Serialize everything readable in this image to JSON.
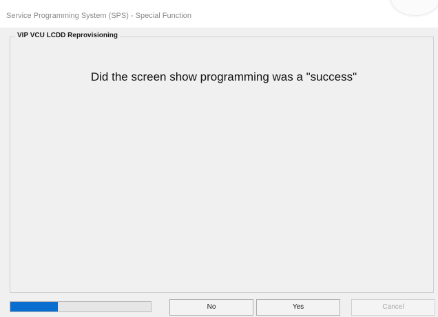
{
  "window": {
    "title": "Service Programming System (SPS) - Special Function"
  },
  "group": {
    "legend": "VIP VCU LCDD Reprovisioning"
  },
  "prompt": {
    "text": "Did the screen show programming was a \"success\""
  },
  "progress": {
    "fraction": 0.34
  },
  "buttons": {
    "no": "No",
    "yes": "Yes",
    "cancel": "Cancel"
  },
  "colors": {
    "progress_fill": "#0a6ed1",
    "window_bg": "#f0f0f0"
  }
}
